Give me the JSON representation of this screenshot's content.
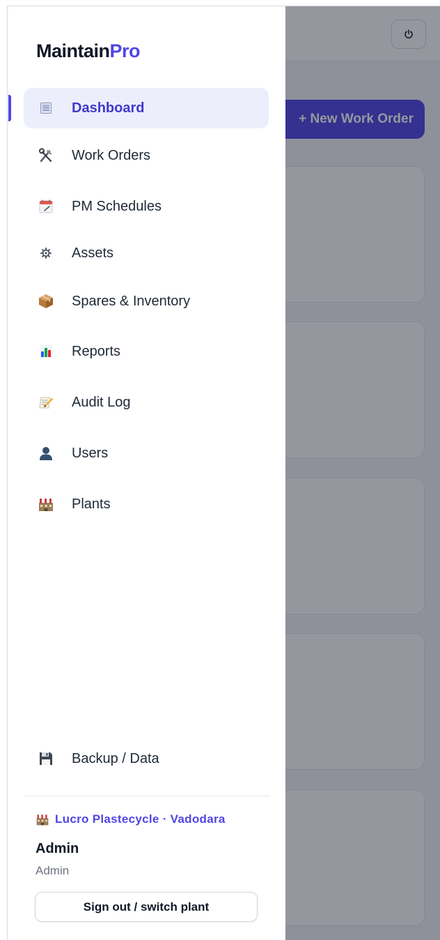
{
  "brand": {
    "name_main": "Maintain",
    "name_accent": "Pro"
  },
  "colors": {
    "accent": "#4f46e5",
    "active_bg": "#eceefc",
    "overlay": "rgba(17,24,39,0.45)"
  },
  "nav": {
    "items": [
      {
        "label": "Dashboard",
        "icon": "dashboard-icon",
        "active": true
      },
      {
        "label": "Work Orders",
        "icon": "tools-icon",
        "active": false
      },
      {
        "label": "PM Schedules",
        "icon": "calendar-icon",
        "active": false
      },
      {
        "label": "Assets",
        "icon": "gear-icon",
        "active": false
      },
      {
        "label": "Spares & Inventory",
        "icon": "package-icon",
        "active": false
      },
      {
        "label": "Reports",
        "icon": "bar-chart-icon",
        "active": false
      },
      {
        "label": "Audit Log",
        "icon": "memo-icon",
        "active": false
      },
      {
        "label": "Users",
        "icon": "user-icon",
        "active": false
      },
      {
        "label": "Plants",
        "icon": "factory-icon",
        "active": false
      }
    ],
    "backup": {
      "label": "Backup / Data",
      "icon": "floppy-disk-icon"
    }
  },
  "footer": {
    "plant": "Lucro Plastecycle · Vadodara",
    "user_name": "Admin",
    "user_role": "Admin",
    "signout_label": "Sign out / switch plant"
  },
  "background": {
    "new_work_order_label": "+ New Work Order",
    "power_icon": "power-icon"
  }
}
